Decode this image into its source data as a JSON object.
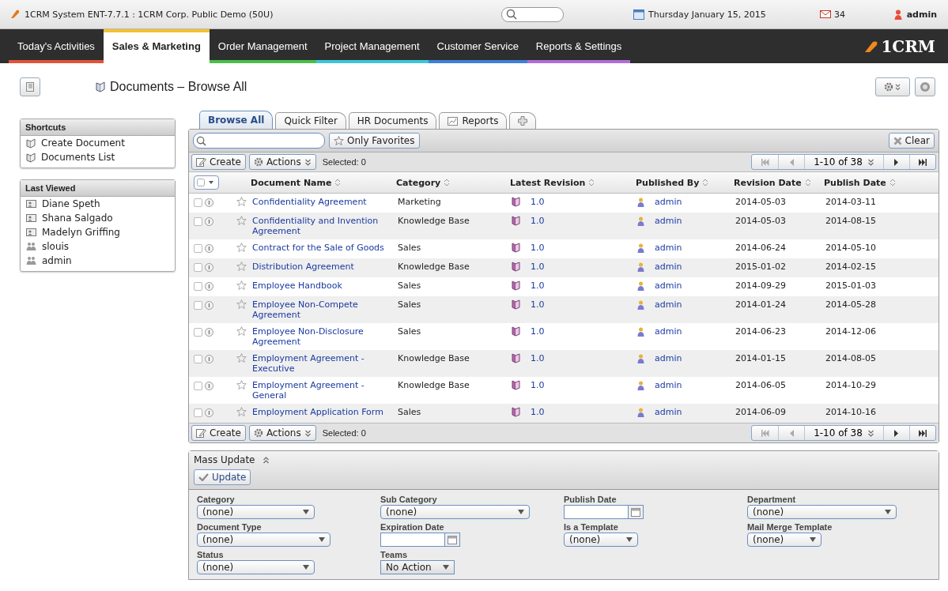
{
  "topbar": {
    "title": "1CRM System ENT-7.7.1 : 1CRM Corp. Public Demo (50U)",
    "date": "Thursday January 15, 2015",
    "mail_count": "34",
    "user": "admin"
  },
  "nav": [
    {
      "label": "Today's Activities",
      "selected": false,
      "color": "#e0533a"
    },
    {
      "label": "Sales & Marketing",
      "selected": true,
      "color": "#f2c230"
    },
    {
      "label": "Order Management",
      "selected": false,
      "color": "#4cbf4c"
    },
    {
      "label": "Project Management",
      "selected": false,
      "color": "#3fc6d8"
    },
    {
      "label": "Customer Service",
      "selected": false,
      "color": "#3f7fd8"
    },
    {
      "label": "Reports & Settings",
      "selected": false,
      "color": "#b06fd8"
    }
  ],
  "logo": "1CRM",
  "page_title": "Documents – Browse All",
  "shortcuts": {
    "title": "Shortcuts",
    "items": [
      "Create Document",
      "Documents List"
    ]
  },
  "last_viewed": {
    "title": "Last Viewed",
    "items": [
      {
        "label": "Diane Speth",
        "kind": "contact"
      },
      {
        "label": "Shana Salgado",
        "kind": "contact"
      },
      {
        "label": "Madelyn Griffing",
        "kind": "contact"
      },
      {
        "label": "slouis",
        "kind": "user"
      },
      {
        "label": "admin",
        "kind": "user"
      }
    ]
  },
  "tabs": [
    {
      "label": "Browse All",
      "selected": true,
      "kind": "text"
    },
    {
      "label": "Quick Filter",
      "selected": false,
      "kind": "text"
    },
    {
      "label": "HR Documents",
      "selected": false,
      "kind": "text"
    },
    {
      "label": "Reports",
      "selected": false,
      "kind": "chart"
    },
    {
      "selected": false,
      "kind": "add"
    }
  ],
  "filter": {
    "favorites": "Only Favorites",
    "clear": "Clear"
  },
  "toolbars": [
    {
      "create": "Create",
      "actions": "Actions",
      "selected": "Selected: 0",
      "pager": "1-10 of 38"
    },
    {
      "create": "Create",
      "actions": "Actions",
      "selected": "Selected: 0",
      "pager": "1-10 of 38"
    }
  ],
  "columns": [
    "Document Name",
    "Category",
    "Latest Revision",
    "Published By",
    "Revision Date",
    "Publish Date"
  ],
  "rows": [
    {
      "checked": false,
      "name": "Confidentiality Agreement",
      "category": "Marketing",
      "revision": "1.0",
      "published_by": "admin",
      "revision_date": "2014-05-03",
      "publish_date": "2014-03-11"
    },
    {
      "checked": false,
      "name": "Confidentiality and Invention Agreement",
      "category": "Knowledge Base",
      "revision": "1.0",
      "published_by": "admin",
      "revision_date": "2014-05-03",
      "publish_date": "2014-08-15"
    },
    {
      "checked": false,
      "name": "Contract for the Sale of Goods",
      "category": "Sales",
      "revision": "1.0",
      "published_by": "admin",
      "revision_date": "2014-06-24",
      "publish_date": "2014-05-10"
    },
    {
      "checked": false,
      "name": "Distribution Agreement",
      "category": "Knowledge Base",
      "revision": "1.0",
      "published_by": "admin",
      "revision_date": "2015-01-02",
      "publish_date": "2014-02-15"
    },
    {
      "checked": false,
      "name": "Employee Handbook",
      "category": "Sales",
      "revision": "1.0",
      "published_by": "admin",
      "revision_date": "2014-09-29",
      "publish_date": "2015-01-03"
    },
    {
      "checked": false,
      "name": "Employee Non-Compete Agreement",
      "category": "Sales",
      "revision": "1.0",
      "published_by": "admin",
      "revision_date": "2014-01-24",
      "publish_date": "2014-05-28"
    },
    {
      "checked": false,
      "name": "Employee Non-Disclosure Agreement",
      "category": "Sales",
      "revision": "1.0",
      "published_by": "admin",
      "revision_date": "2014-06-23",
      "publish_date": "2014-12-06"
    },
    {
      "checked": false,
      "name": "Employment Agreement - Executive",
      "category": "Knowledge Base",
      "revision": "1.0",
      "published_by": "admin",
      "revision_date": "2014-01-15",
      "publish_date": "2014-08-05"
    },
    {
      "checked": false,
      "name": "Employment Agreement - General",
      "category": "Knowledge Base",
      "revision": "1.0",
      "published_by": "admin",
      "revision_date": "2014-06-05",
      "publish_date": "2014-10-29"
    },
    {
      "checked": false,
      "name": "Employment Application Form",
      "category": "Sales",
      "revision": "1.0",
      "published_by": "admin",
      "revision_date": "2014-06-09",
      "publish_date": "2014-10-16"
    }
  ],
  "mass_update": {
    "title": "Mass Update",
    "button": "Update",
    "fields": [
      {
        "label": "Category",
        "kind": "select",
        "value": "(none)"
      },
      {
        "label": "Sub Category",
        "kind": "select",
        "value": "(none)"
      },
      {
        "label": "Publish Date",
        "kind": "date"
      },
      {
        "label": "Department",
        "kind": "select",
        "value": "(none)"
      },
      {
        "label": "Document Type",
        "kind": "select",
        "value": "(none)"
      },
      {
        "label": "Expiration Date",
        "kind": "date"
      },
      {
        "label": "Is a Template",
        "kind": "select",
        "value": "(none)"
      },
      {
        "label": "Mail Merge Template",
        "kind": "select",
        "value": "(none)"
      },
      {
        "label": "Status",
        "kind": "select",
        "value": "(none)"
      },
      {
        "label": "Teams",
        "kind": "select",
        "value": "No Action"
      }
    ]
  }
}
